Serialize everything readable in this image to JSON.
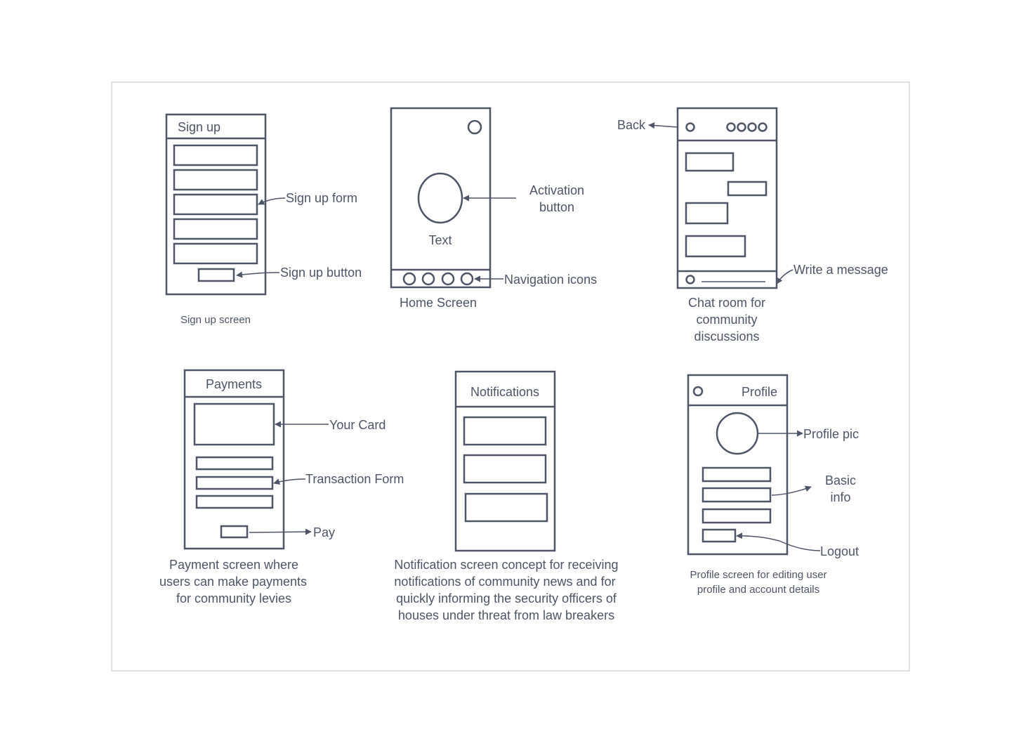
{
  "colors": {
    "stroke": "#4d5566",
    "text": "#4d5566",
    "frame": "#d6d8dc",
    "background": "#ffffff"
  },
  "signup": {
    "header": "Sign up",
    "form_label": "Sign up form",
    "button_label": "Sign up button",
    "caption": "Sign up screen"
  },
  "home": {
    "center_text": "Text",
    "activation_label": [
      "Activation",
      "button"
    ],
    "nav_label": "Navigation icons",
    "caption": "Home Screen"
  },
  "chat": {
    "back_label": "Back",
    "write_label": "Write a message",
    "caption": [
      "Chat room for",
      "community",
      "discussions"
    ]
  },
  "payments": {
    "header": "Payments",
    "card_label": "Your Card",
    "form_label": "Transaction Form",
    "pay_label": "Pay",
    "caption": [
      "Payment screen where",
      "users can make payments",
      "for community levies"
    ]
  },
  "notifications": {
    "header": "Notifications",
    "caption": [
      "Notification screen concept for receiving",
      "notifications of community news and for",
      "quickly informing the security officers of",
      "houses under threat from law breakers"
    ]
  },
  "profile": {
    "header": "Profile",
    "pic_label": "Profile pic",
    "info_label": [
      "Basic",
      "info"
    ],
    "logout_label": "Logout",
    "caption": [
      "Profile screen for editing user",
      "profile and account details"
    ]
  }
}
